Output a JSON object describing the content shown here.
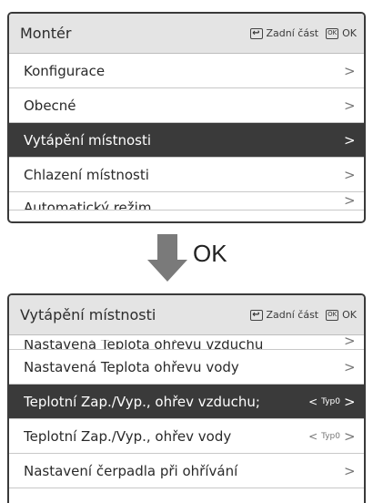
{
  "screen1": {
    "title": "Montér",
    "back_label": "Zadní část",
    "ok_label": "OK",
    "items": [
      {
        "label": "Konfigurace",
        "chevron": ">"
      },
      {
        "label": "Obecné",
        "chevron": ">"
      },
      {
        "label": "Vytápění místnosti",
        "chevron": ">"
      },
      {
        "label": "Chlazení místnosti",
        "chevron": ">"
      },
      {
        "label": "Automatický režim",
        "chevron": ">"
      }
    ],
    "selected_index": 2
  },
  "transition": {
    "label": "OK"
  },
  "screen2": {
    "title": "Vytápění místnosti",
    "back_label": "Zadní část",
    "ok_label": "OK",
    "items": [
      {
        "label": "Nastavená Teplota ohřevu vzduchu",
        "chevron": ">"
      },
      {
        "label": "Nastavená Teplota ohřevu vody",
        "chevron": ">"
      },
      {
        "label": "Teplotní Zap./Vyp., ohřev vzduchu;",
        "value": "Typ0",
        "chevron": ">"
      },
      {
        "label": "Teplotní Zap./Vyp., ohřev vody",
        "value": "Typ0",
        "chevron": ">"
      },
      {
        "label": "Nastavení čerpadla při ohřívání",
        "chevron": ">"
      }
    ],
    "selected_index": 2
  },
  "icons": {
    "back": "back-key-icon",
    "ok": "ok-key-icon",
    "down_arrow": "down-arrow-icon"
  },
  "colors": {
    "selected_bg": "#3a3a3a",
    "header_bg": "#e4e4e4"
  }
}
